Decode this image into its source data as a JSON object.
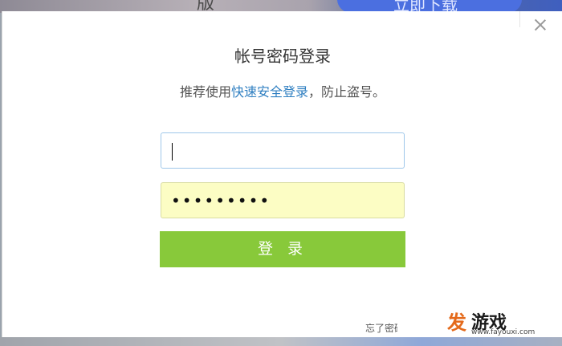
{
  "background": {
    "top_text": "版",
    "top_button_label": "立即下载"
  },
  "dialog": {
    "title": "帐号密码登录",
    "subtitle_prefix": "推荐使用",
    "subtitle_link": "快速安全登录",
    "subtitle_suffix": "，防止盗号。",
    "username_value": "",
    "password_value": "•••••••••",
    "login_button_label": "登 录",
    "forgot_label": "忘了密码"
  },
  "watermark": {
    "logo": "发",
    "name": "游戏",
    "url": "www.fayouxi.com"
  },
  "colors": {
    "login_button": "#88c93a",
    "link": "#2f7fc1",
    "password_fill": "#fcfdc4",
    "username_border": "#9fc7ea"
  },
  "icons": {
    "close": "close-icon"
  }
}
